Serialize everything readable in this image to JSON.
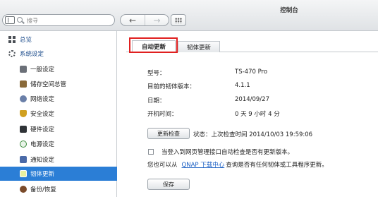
{
  "window": {
    "title": "控制台"
  },
  "search": {
    "placeholder": "搜寻"
  },
  "toolbar": {
    "back": "←",
    "forward": "→"
  },
  "sidebar": {
    "items": [
      {
        "label": "总览"
      },
      {
        "label": "系统设定"
      },
      {
        "label": "一般设定"
      },
      {
        "label": "储存空间总管"
      },
      {
        "label": "网络设定"
      },
      {
        "label": "安全设定"
      },
      {
        "label": "硬件设定"
      },
      {
        "label": "电源设定"
      },
      {
        "label": "通知设定"
      },
      {
        "label": "韧体更新"
      },
      {
        "label": "备份/恢复"
      }
    ],
    "selected": "韧体更新"
  },
  "tabs": [
    {
      "label": "自动更新",
      "active": true
    },
    {
      "label": "韧体更新",
      "active": false
    }
  ],
  "info": {
    "model_label": "型号：",
    "model_value": "TS-470 Pro",
    "fw_label": "目前的韧体版本：",
    "fw_value": "4.1.1",
    "date_label": "日期：",
    "date_value": "2014/09/27",
    "uptime_label": "开机时间：",
    "uptime_value": "0 天 9 小时 4 分"
  },
  "update": {
    "check_button": "更新检查",
    "status": "状态：上次检查时间 2014/10/03 19:59:06",
    "auto_check_label": "当登入到网页管理接口自动检查是否有更新版本。",
    "auto_check_checked": false,
    "info_prefix": "您也可以从",
    "link_text": "QNAP 下载中心",
    "info_suffix": "查询是否有任何韧体或工具程序更新。",
    "save_button": "保存"
  },
  "colors": {
    "accent": "#2b7ed6",
    "highlight": "#e02020",
    "link": "#1a5fc4"
  }
}
